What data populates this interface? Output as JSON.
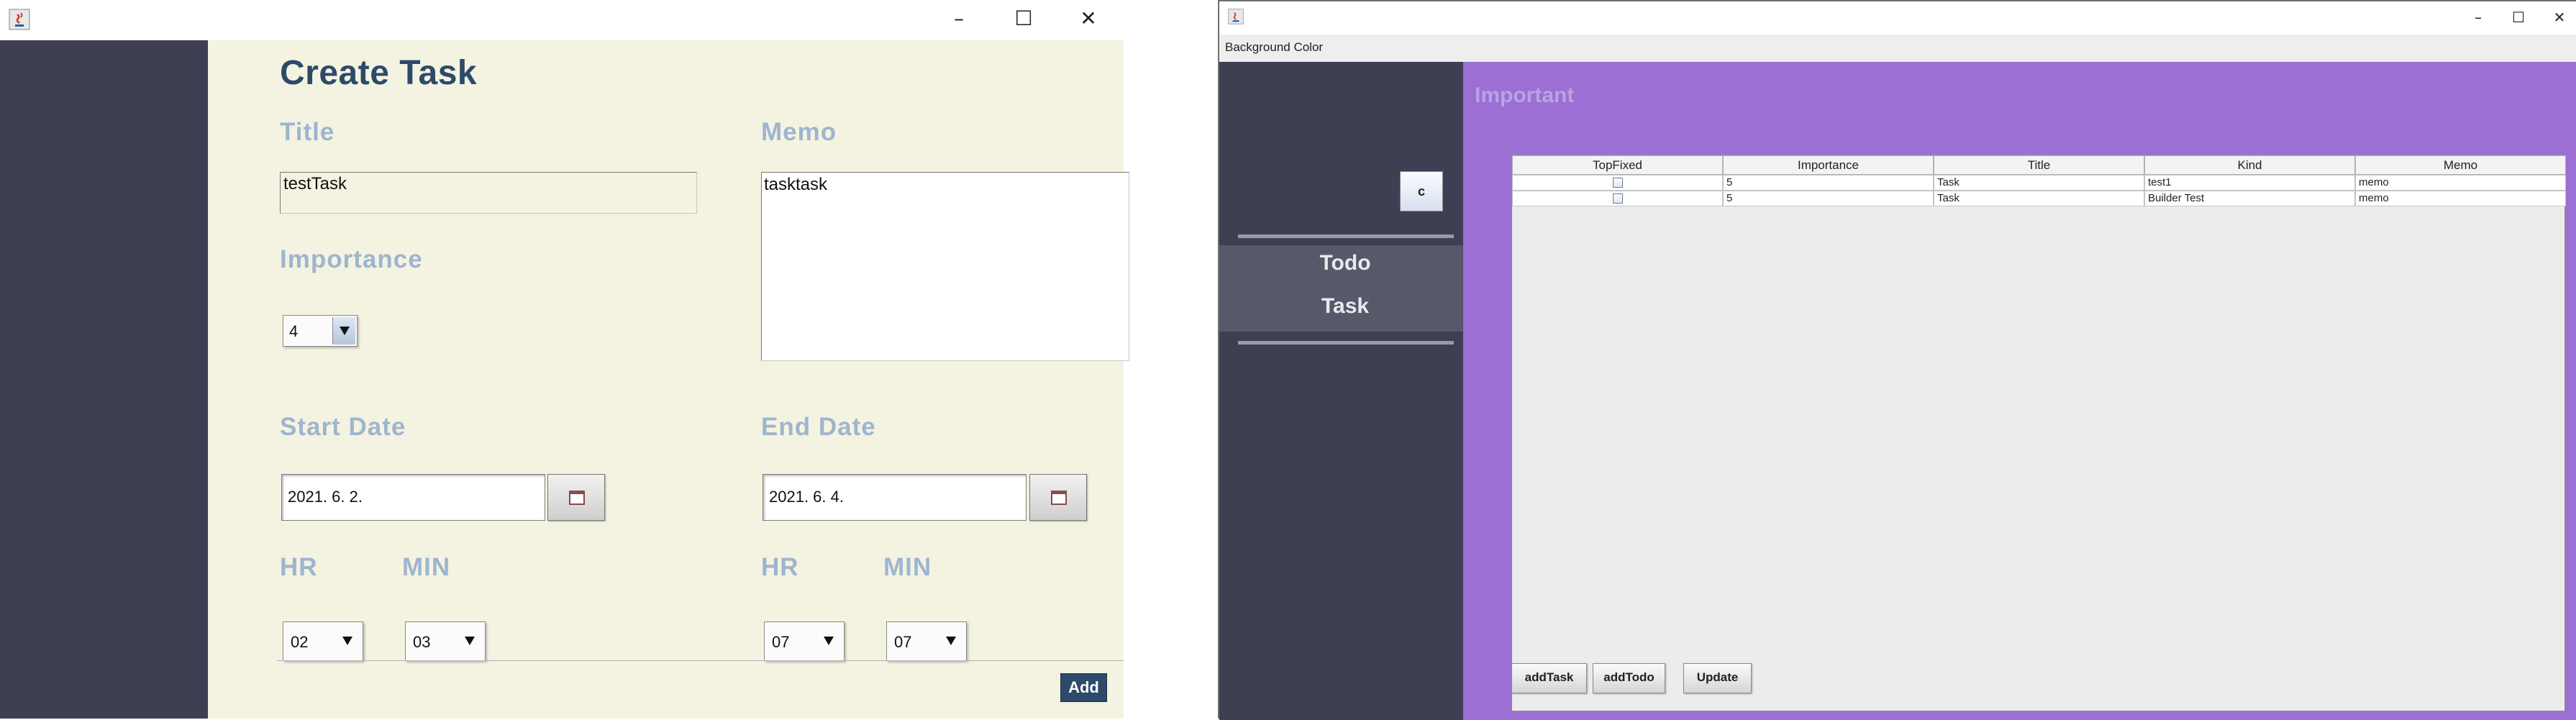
{
  "create_task_window": {
    "window_controls": {
      "minimize": "–",
      "maximize": "☐",
      "close": "✕"
    },
    "heading": "Create Task",
    "title_label": "Title",
    "title_value": "testTask",
    "memo_label": "Memo",
    "memo_value": "tasktask",
    "importance_label": "Importance",
    "importance_value": "4",
    "start_date_label": "Start Date",
    "start_date_value": "2021. 6. 2.",
    "end_date_label": "End Date",
    "end_date_value": "2021. 6. 4.",
    "hr_label": "HR",
    "min_label": "MIN",
    "start_hr": "02",
    "start_min": "03",
    "end_hr": "07",
    "end_min": "07",
    "add_button": "Add",
    "colors": {
      "sidebar": "#3e3f53",
      "content": "#f4f3e1",
      "heading": "#2d4a6a",
      "label": "#9eb5cf",
      "add_button": "#2d4a6a"
    }
  },
  "important_window": {
    "window_controls": {
      "minimize": "–",
      "maximize": "☐",
      "close": "✕"
    },
    "menu": {
      "background_color": "Background Color"
    },
    "sidebar": {
      "c_button": "c",
      "nav_items": [
        "Todo",
        "Task"
      ]
    },
    "section_title": "Important",
    "table": {
      "columns": [
        "TopFixed",
        "Importance",
        "Title",
        "Kind",
        "Memo"
      ],
      "rows": [
        {
          "importance": "5",
          "title": "Task",
          "kind": "test1",
          "memo": "memo"
        },
        {
          "importance": "5",
          "title": "Task",
          "kind": "Builder Test",
          "memo": "memo"
        }
      ]
    },
    "buttons": {
      "add_task": "addTask",
      "add_todo": "addTodo",
      "update": "Update"
    },
    "colors": {
      "sidebar": "#3e3f53",
      "content": "#9b6fd3",
      "section_title": "#b9a3e3"
    }
  }
}
